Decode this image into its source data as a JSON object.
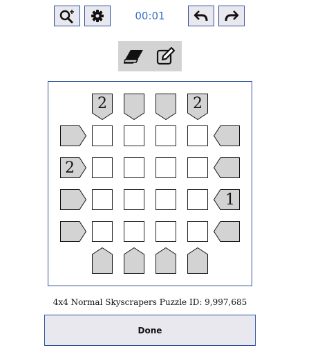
{
  "toolbar": {
    "timer": "00:01",
    "icons": [
      "zoom-in-icon",
      "gear-icon",
      "undo-icon",
      "redo-icon"
    ]
  },
  "tools": {
    "icons": [
      "eraser-icon",
      "pencil-edit-icon"
    ]
  },
  "puzzle": {
    "size": 4,
    "clues": {
      "top": [
        "2",
        "",
        "",
        "2"
      ],
      "bottom": [
        "",
        "",
        "",
        ""
      ],
      "left": [
        "",
        "2",
        "",
        ""
      ],
      "right": [
        "",
        "",
        "1",
        ""
      ]
    },
    "grid": [
      [
        "",
        "",
        "",
        ""
      ],
      [
        "",
        "",
        "",
        ""
      ],
      [
        "",
        "",
        "",
        ""
      ],
      [
        "",
        "",
        "",
        ""
      ]
    ]
  },
  "caption": "4x4 Normal Skyscrapers Puzzle ID: 9,997,685",
  "done_label": "Done",
  "colors": {
    "accent": "#2b4f9e",
    "timer": "#3a6ec8",
    "clue_fill": "#d3d3d3"
  }
}
